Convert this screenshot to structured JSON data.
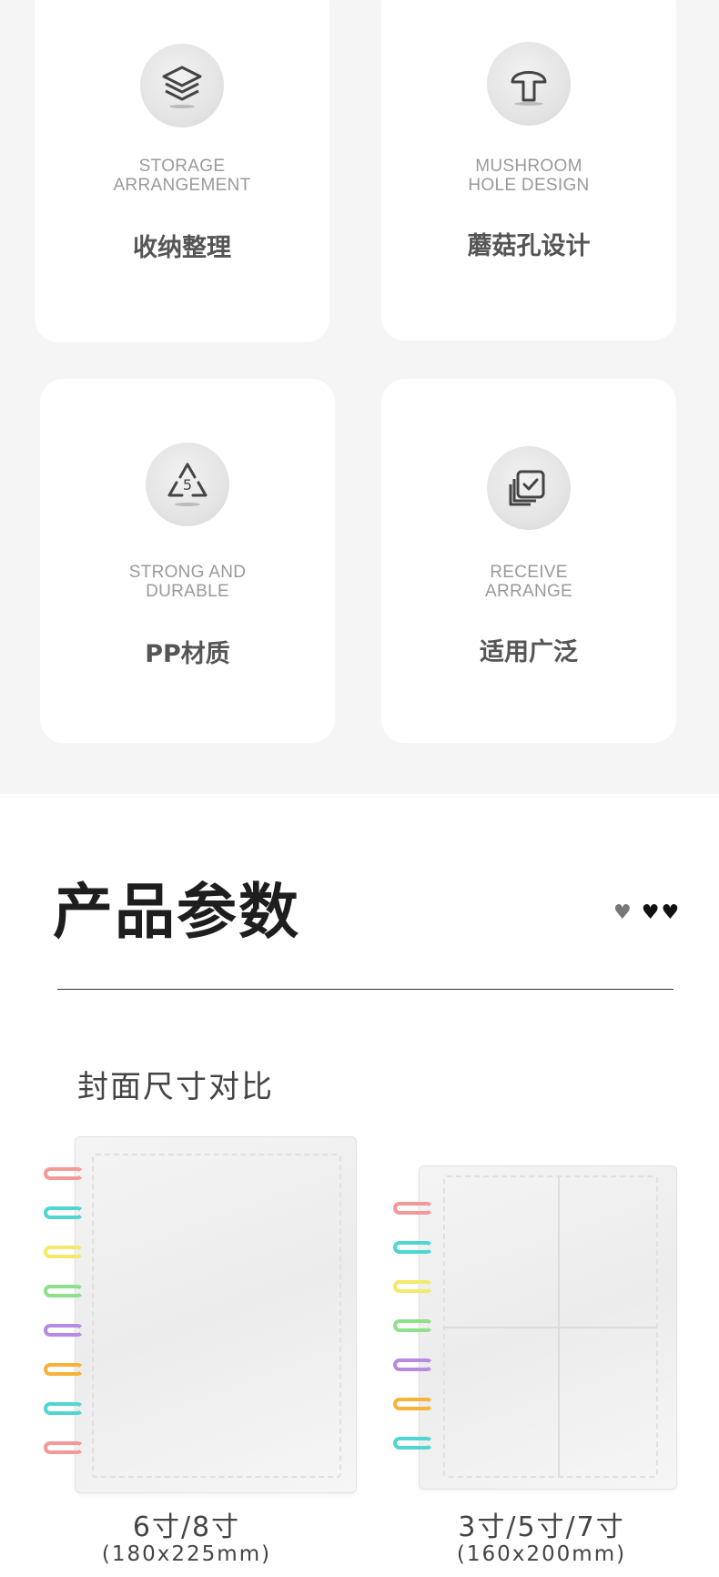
{
  "features": [
    {
      "icon": "layers-icon",
      "en": "STORAGE\nARRANGEMENT",
      "cn": "收纳整理"
    },
    {
      "icon": "mushroom-icon",
      "en": "MUSHROOM\nHOLE DESIGN",
      "cn": "蘑菇孔设计"
    },
    {
      "icon": "recycle-5-icon",
      "en": "STRONG AND\nDURABLE",
      "cn": "PP材质"
    },
    {
      "icon": "stacked-check-icon",
      "en": "RECEIVE\nARRANGE",
      "cn": "适用广泛"
    }
  ],
  "params": {
    "title": "产品参数",
    "subtitle": "封面尺寸对比"
  },
  "albums": [
    {
      "size": "6寸/8寸",
      "mm": "(180x225mm)",
      "ring_colors": [
        "#f29a9a",
        "#4fd6d0",
        "#f2ea6a",
        "#8ee08a",
        "#b98be0",
        "#f8b23a",
        "#4fd6d0",
        "#f29a9a"
      ]
    },
    {
      "size": "3寸/5寸/7寸",
      "mm": "(160x200mm)",
      "ring_colors": [
        "#f29a9a",
        "#4fd6d0",
        "#f2ea6a",
        "#8ee08a",
        "#b98be0",
        "#f8b23a",
        "#4fd6d0"
      ]
    }
  ]
}
